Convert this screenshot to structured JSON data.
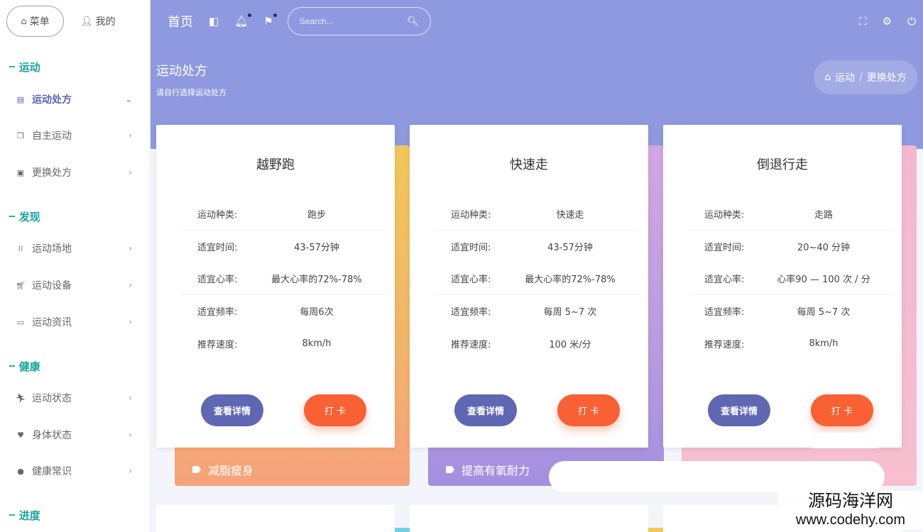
{
  "sidebar": {
    "tabs": [
      {
        "label": "菜单",
        "icon": "home-icon"
      },
      {
        "label": "我的",
        "icon": "user-icon"
      }
    ],
    "groups": [
      "运动",
      "发现",
      "健康",
      "进度"
    ],
    "items": [
      {
        "label": "运动处方",
        "icon": "document-icon",
        "active": true
      },
      {
        "label": "自主运动",
        "icon": "copy-icon"
      },
      {
        "label": "更换处方",
        "icon": "calendar-icon"
      },
      {
        "label": "运动场地",
        "icon": "grid-icon"
      },
      {
        "label": "运动设备",
        "icon": "cart-icon"
      },
      {
        "label": "运动资讯",
        "icon": "monitor-icon"
      },
      {
        "label": "运动状态",
        "icon": "runner-icon"
      },
      {
        "label": "身体状态",
        "icon": "heart-icon"
      },
      {
        "label": "健康常识",
        "icon": "apple-icon"
      }
    ]
  },
  "navbar": {
    "title": "首页",
    "search_placeholder": "Search..."
  },
  "page": {
    "title": "运动处方",
    "subtitle": "请自行选择运动处方",
    "breadcrumb": [
      "运动",
      "/",
      "更换处方"
    ]
  },
  "cards": [
    {
      "title": "越野跑",
      "rows": [
        [
          "运动种类:",
          "跑步"
        ],
        [
          "适宜时间:",
          "43-57分钟"
        ],
        [
          "适宜心率:",
          "最大心率的72%-78%"
        ],
        [
          "适宜频率:",
          "每周6次"
        ],
        [
          "推荐速度:",
          "8km/h"
        ]
      ],
      "detail": "查看详情",
      "checkin": "打 卡",
      "tag": "减脂瘦身"
    },
    {
      "title": "快速走",
      "rows": [
        [
          "运动种类:",
          "快速走"
        ],
        [
          "适宜时间:",
          "43-57分钟"
        ],
        [
          "适宜心率:",
          "最大心率的72%-78%"
        ],
        [
          "适宜频率:",
          "每周 5~7 次"
        ],
        [
          "推荐速度:",
          "100 米/分"
        ]
      ],
      "detail": "查看详情",
      "checkin": "打 卡",
      "tag": "提高有氧耐力"
    },
    {
      "title": "倒退行走",
      "rows": [
        [
          "运动种类:",
          "走路"
        ],
        [
          "适宜时间:",
          "20~40 分钟"
        ],
        [
          "适宜心率:",
          "心率90 — 100 次 / 分"
        ],
        [
          "适宜频率:",
          "每周 5~7 次"
        ],
        [
          "推荐速度:",
          "8km/h"
        ]
      ],
      "detail": "查看详情",
      "checkin": "打 卡",
      "tag": ""
    }
  ],
  "watermark": {
    "line1": "源码海洋网",
    "line2": "www.codehy.com"
  },
  "colors": {
    "sidebar_group": "#1aa59e",
    "top_band": "#8f99e0",
    "detail_button": "#5f67b3",
    "checkin_button": "#f96033"
  }
}
